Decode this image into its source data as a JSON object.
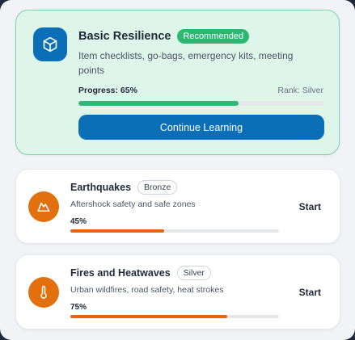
{
  "featured": {
    "title": "Basic Resilience",
    "badge": "Recommended",
    "description": "Item checklists, go-bags, emergency kits, meeting points",
    "progress_label": "Progress: 65%",
    "progress_fraction": 0.65,
    "rank": "Rank: Silver",
    "button_label": "Continue Learning",
    "icon": "cube-icon"
  },
  "modules": [
    {
      "title": "Earthquakes",
      "rank": "Bronze",
      "description": "Aftershock safety and safe zones",
      "progress_label": "45%",
      "progress_fraction": 0.45,
      "action_label": "Start",
      "icon": "mountain-icon"
    },
    {
      "title": "Fires and Heatwaves",
      "rank": "Silver",
      "description": "Urban wildfires, road safety, heat strokes",
      "progress_label": "75%",
      "progress_fraction": 0.75,
      "action_label": "Start",
      "icon": "thermometer-icon"
    }
  ],
  "colors": {
    "primary_blue": "#0b6fb8",
    "success_green": "#2fb87a",
    "badge_green": "#2eb673",
    "warning_orange": "#e8650e",
    "icon_orange": "#e3700f"
  }
}
